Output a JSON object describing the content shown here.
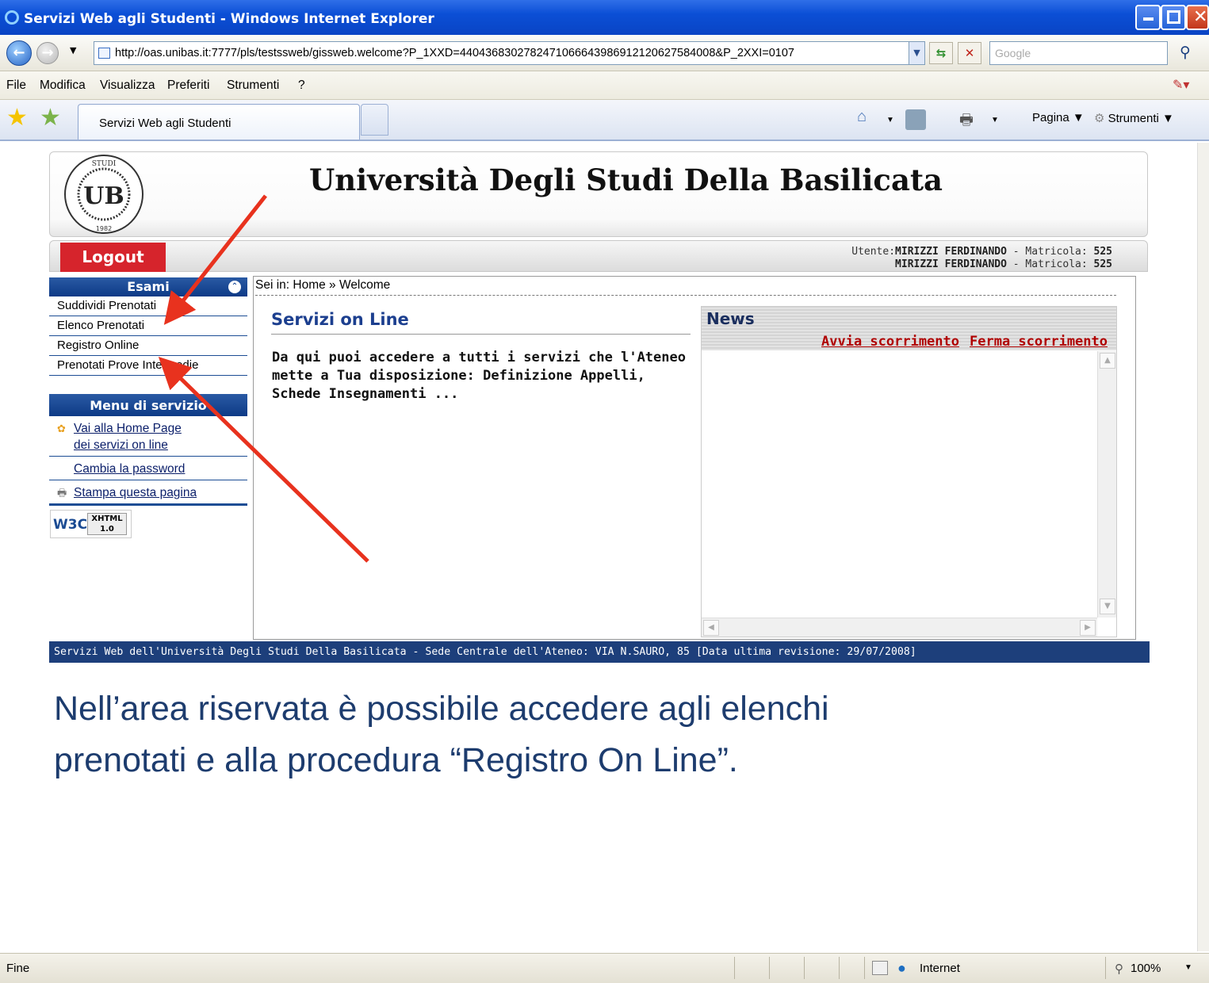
{
  "window": {
    "title": "Servizi Web agli Studenti - Windows Internet Explorer"
  },
  "address_bar": {
    "url": "http://oas.unibas.it:7777/pls/testssweb/gissweb.welcome?P_1XXD=4404368302782471066643986912120627584008&P_2XXI=0107",
    "search_placeholder": "Google"
  },
  "menu": [
    "File",
    "Modifica",
    "Visualizza",
    "Preferiti",
    "Strumenti",
    "?"
  ],
  "tab": {
    "label": "Servizi Web agli Studenti"
  },
  "toolbar": {
    "page_label": "Pagina",
    "tools_label": "Strumenti"
  },
  "page": {
    "university_name": "Università Degli Studi Della Basilicata",
    "logo_text": {
      "top": "STUDI",
      "year": "1982",
      "initials": "UB"
    },
    "logout_label": "Logout",
    "user_line1": {
      "prefix": "Utente:",
      "name": "MIRIZZI FERDINANDO",
      "mid": " - Matricola: ",
      "matricola": "525"
    },
    "user_line2": {
      "name": "MIRIZZI FERDINANDO",
      "mid": " - Matricola: ",
      "matricola": "525"
    },
    "breadcrumb": "Sei in: Home » Welcome"
  },
  "esami_menu": {
    "title": "Esami",
    "items": [
      "Suddividi Prenotati",
      "Elenco Prenotati",
      "Registro Online",
      "Prenotati Prove Intermedie"
    ]
  },
  "service_menu": {
    "title": "Menu di servizio",
    "items": [
      "Vai alla Home Page dei servizi on line",
      "Cambia la password",
      "Stampa questa pagina"
    ]
  },
  "w3c_badge": {
    "w3c": "W3C",
    "label": "XHTML 1.0"
  },
  "main": {
    "section_title": "Servizi on Line",
    "description": "Da qui puoi accedere a tutti i servizi che l'Ateneo mette a Tua disposizione: Definizione Appelli, Schede Insegnamenti ..."
  },
  "news": {
    "title": "News",
    "start_link": "Avvia scorrimento",
    "stop_link": "Ferma scorrimento"
  },
  "footer": {
    "text": "Servizi Web dell'Università Degli Studi Della Basilicata - Sede Centrale dell'Ateneo: VIA N.SAURO, 85 [Data ultima revisione: 29/07/2008]"
  },
  "caption": {
    "line1": "Nell’area riservata è possibile accedere agli elenchi",
    "line2": "prenotati e alla procedura “Registro On Line”."
  },
  "status_bar": {
    "left": "Fine",
    "zone": "Internet",
    "zoom": "100%"
  },
  "colors": {
    "arrow": "#e8321e",
    "logout_bg": "#d6242c",
    "nav_blue": "#1d3f7b",
    "link_red": "#b00000"
  }
}
